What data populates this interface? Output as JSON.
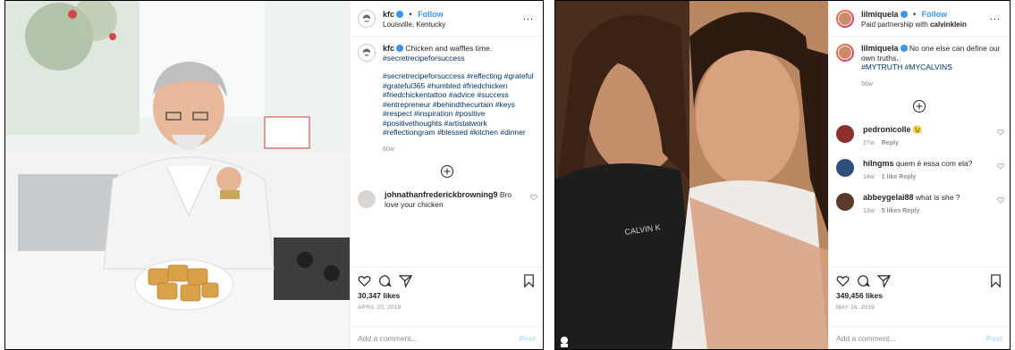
{
  "posts": [
    {
      "username": "kfc",
      "follow": "Follow",
      "separator": "•",
      "more": "...",
      "subline": "Louisville, Kentucky",
      "caption_user": "kfc",
      "caption_text": "Chicken and waffles time.",
      "caption_tags_1": "#secretrecipeforsuccess",
      "caption_tags_2": "#secretrecipeforsuccess #reflecting #grateful #grateful365 #humbled #friedchicken #friedchickentattoo #advice #success #entrepreneur #behindthecurtain #keys #respect #inspiration #positive #positivethoughts #artistatwork #reflectiongram #blessed #kitchen #dinner",
      "caption_age": "60w",
      "comments": [
        {
          "user": "johnathanfrederickbrowning9",
          "text": "Bro love your chicken"
        }
      ],
      "likes": "30,347 likes",
      "date": "APRIL 20, 2019",
      "add_comment": "Add a comment...",
      "post_button": "Post",
      "colors": {
        "accent": "#3897f0",
        "tags": "#003569",
        "muted": "#8e8e8e"
      }
    },
    {
      "username": "lilmiquela",
      "follow": "Follow",
      "separator": "•",
      "more": "...",
      "subline_prefix": "Paid partnership with",
      "subline_partner": "calvinklein",
      "caption_user": "lilmiquela",
      "caption_text": "No one else can define our own truths.",
      "caption_tags_1": "#MYTRUTH #MYCALVINS",
      "caption_age": "56w",
      "comments": [
        {
          "user": "pedronicolle",
          "text": "😉",
          "meta_age": "27w",
          "meta_reply": "Reply"
        },
        {
          "user": "hilngms",
          "text": "quem é essa com ela?",
          "meta_age": "14w",
          "meta_likes": "1 like",
          "meta_reply": "Reply"
        },
        {
          "user": "abbeygelai88",
          "text": "what is she ?",
          "meta_age": "13w",
          "meta_likes": "5 likes",
          "meta_reply": "Reply"
        }
      ],
      "likes": "349,456 likes",
      "date": "MAY 16, 2019",
      "add_comment": "Add a comment...",
      "post_button": "Post",
      "photo_text": {
        "shirt": "CALVIN K",
        "tag_icon": "user-tag-icon"
      }
    }
  ]
}
